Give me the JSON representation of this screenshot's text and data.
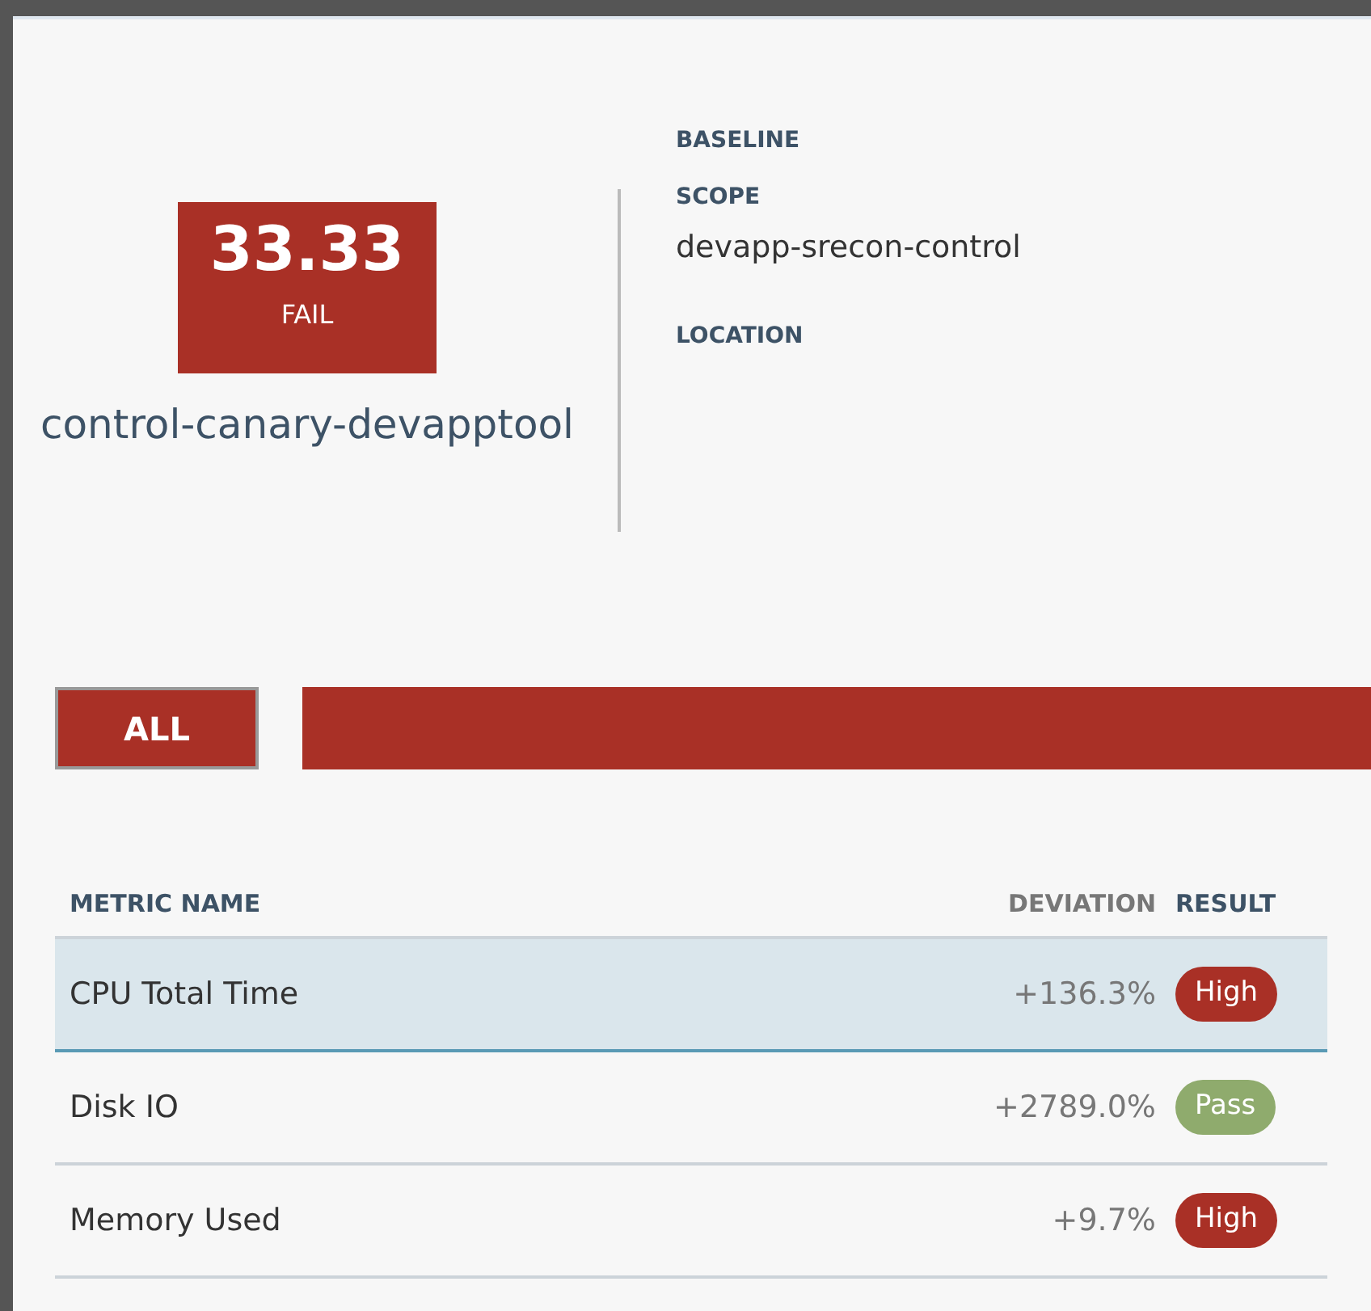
{
  "score": {
    "value": "33.33",
    "verdict": "FAIL",
    "color": "#a93026"
  },
  "name": "control-canary-devapptool",
  "details": [
    {
      "label": "BASELINE"
    },
    {
      "label": "SCOPE",
      "value": "devapp-srecon-control"
    },
    {
      "label": "LOCATION"
    }
  ],
  "tabs": [
    {
      "label": "ALL",
      "selected": true
    }
  ],
  "table": {
    "columns": [
      "METRIC NAME",
      "DEVIATION",
      "RESULT"
    ],
    "rows": [
      {
        "metric": "CPU Total Time",
        "deviation": "+136.3%",
        "result": "High",
        "color": "#a93026",
        "selected": true
      },
      {
        "metric": "Disk IO",
        "deviation": "+2789.0%",
        "result": "Pass",
        "color": "#8fab6d",
        "selected": false
      },
      {
        "metric": "Memory Used",
        "deviation": "+9.7%",
        "result": "High",
        "color": "#a93026",
        "selected": false
      }
    ]
  }
}
